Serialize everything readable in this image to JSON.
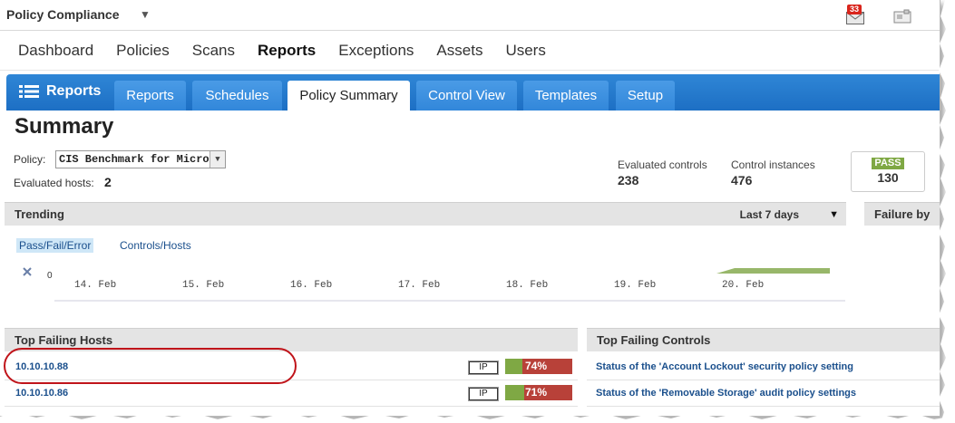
{
  "topbar": {
    "app_name": "Policy Compliance",
    "mail_count": "33"
  },
  "nav": {
    "items": [
      "Dashboard",
      "Policies",
      "Scans",
      "Reports",
      "Exceptions",
      "Assets",
      "Users"
    ],
    "active": "Reports"
  },
  "module": {
    "title": "Reports",
    "tabs": [
      "Reports",
      "Schedules",
      "Policy Summary",
      "Control View",
      "Templates",
      "Setup"
    ],
    "active_tab": "Policy Summary"
  },
  "summary": {
    "title": "Summary",
    "policy_label": "Policy:",
    "policy_value": "CIS Benchmark for Microso",
    "hosts_label": "Evaluated hosts:",
    "hosts_value": "2",
    "evaluated_controls_label": "Evaluated controls",
    "evaluated_controls_value": "238",
    "control_instances_label": "Control instances",
    "control_instances_value": "476",
    "pass_label": "PASS",
    "pass_value": "130"
  },
  "trending": {
    "title": "Trending",
    "range": "Last 7 days",
    "subtabs": [
      "Pass/Fail/Error",
      "Controls/Hosts"
    ],
    "y_zero": "0",
    "dates": [
      "14. Feb",
      "15. Feb",
      "16. Feb",
      "17. Feb",
      "18. Feb",
      "19. Feb",
      "20. Feb"
    ]
  },
  "failure_header": "Failure by",
  "top_failing_hosts": {
    "title": "Top Failing Hosts",
    "rows": [
      {
        "host": "10.10.10.88",
        "type": "IP",
        "pass_fraction": 0.26,
        "fail_percent": "74%"
      },
      {
        "host": "10.10.10.86",
        "type": "IP",
        "pass_fraction": 0.29,
        "fail_percent": "71%"
      }
    ]
  },
  "top_failing_controls": {
    "title": "Top Failing Controls",
    "rows": [
      "Status of the 'Account Lockout' security policy setting",
      "Status of the 'Removable Storage' audit policy settings"
    ]
  },
  "colors": {
    "accent_blue": "#1d6fc4",
    "pass_green": "#7fa844",
    "fail_red": "#b84139",
    "link_blue": "#1a4f8c"
  }
}
